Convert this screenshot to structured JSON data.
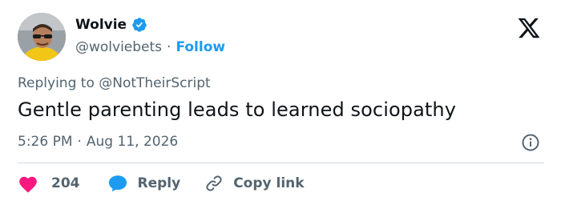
{
  "author": {
    "name": "Wolvie",
    "handle": "@wolviebets",
    "separator": "·",
    "follow_label": "Follow",
    "verified_color": "#1d9bf0"
  },
  "tweet": {
    "replying_to": "Replying to @NotTheirScript",
    "text": "Gentle parenting leads to learned sociopathy",
    "time": "5:26 PM",
    "separator": "·",
    "date": "Aug 11, 2026"
  },
  "actions": {
    "likes_count": "204",
    "reply_label": "Reply",
    "copy_link_label": "Copy link"
  },
  "colors": {
    "like": "#f91880",
    "reply": "#1d9bf0",
    "text_secondary": "#536471"
  },
  "icons": {
    "logo": "x-logo-icon",
    "verified": "verified-badge-icon",
    "info": "info-icon",
    "like": "heart-icon",
    "reply": "speech-bubble-icon",
    "copy": "link-icon"
  }
}
